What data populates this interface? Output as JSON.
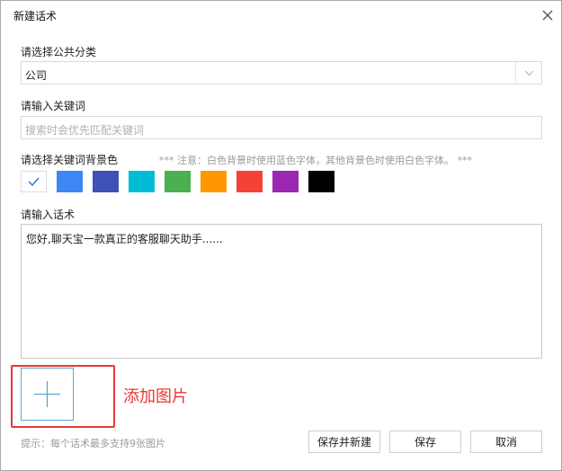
{
  "dialog": {
    "title": "新建话术"
  },
  "category": {
    "label": "请选择公共分类",
    "value": "公司"
  },
  "keyword": {
    "label": "请输入关键词",
    "placeholder": "搜索时会优先匹配关键词"
  },
  "colors": {
    "label": "请选择关键词背景色",
    "note": "*** 注意：白色背景时使用蓝色字体，其他背景色时使用白色字体。 ***",
    "selected": "#ffffff",
    "swatches": [
      "#ffffff",
      "#3d87f5",
      "#3f51b5",
      "#00bcd4",
      "#4caf50",
      "#ff9800",
      "#f44336",
      "#9c27b0",
      "#000000"
    ]
  },
  "script": {
    "label": "请输入话术",
    "value": "您好,聊天宝一款真正的客服聊天助手......"
  },
  "image": {
    "caption": "添加图片",
    "tip": "提示：每个话术最多支持9张图片"
  },
  "buttons": {
    "save_new": "保存并新建",
    "save": "保存",
    "cancel": "取消"
  }
}
